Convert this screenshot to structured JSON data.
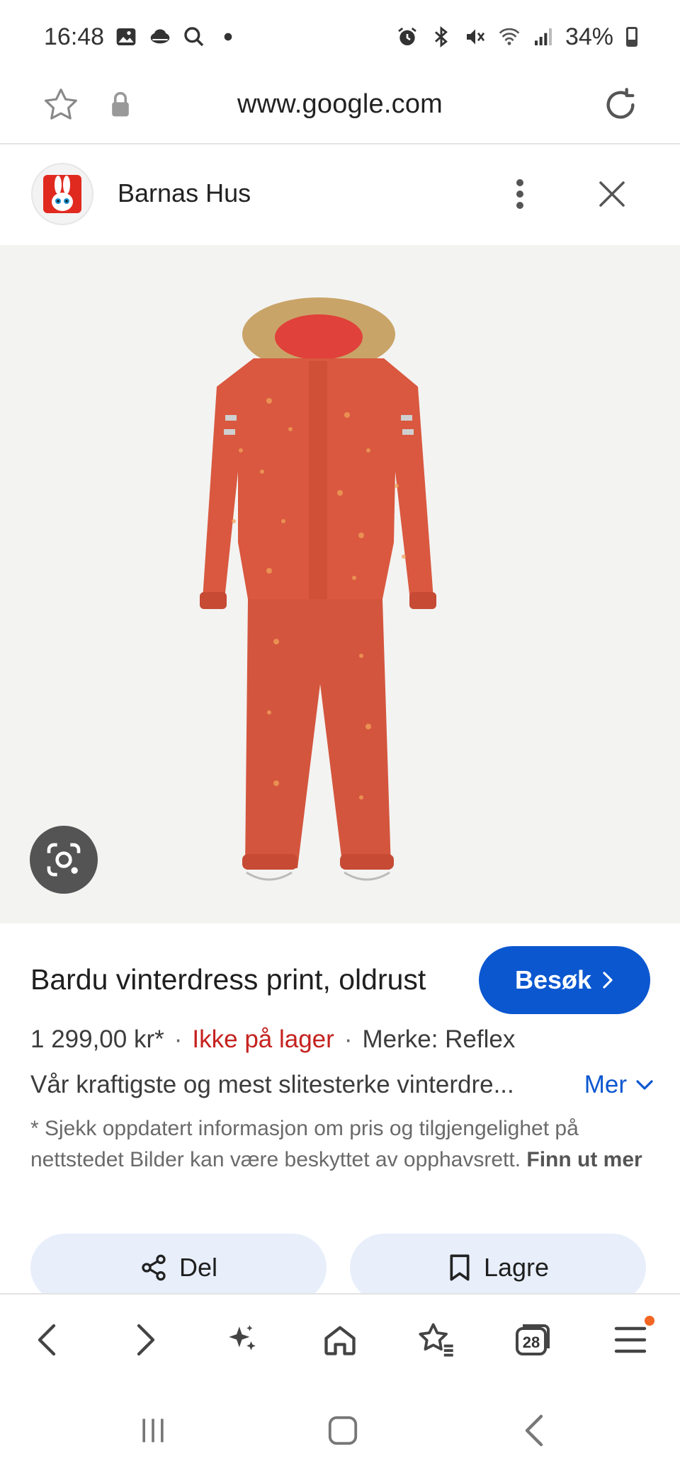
{
  "status_bar": {
    "time": "16:48",
    "battery": "34%"
  },
  "browser": {
    "url": "www.google.com"
  },
  "sheet": {
    "site_name": "Barnas Hus"
  },
  "product": {
    "title": "Bardu vinterdress print, oldrust",
    "visit_label": "Besøk",
    "price": "1 299,00 kr*",
    "stock_status": "Ikke på lager",
    "brand": "Merke: Reflex",
    "description": "Vår kraftigste og mest slitesterke vinterdre...",
    "more_label": "Mer",
    "disclaimer": "* Sjekk oppdatert informasjon om pris og tilgjengelighet på nettstedet Bilder kan være beskyttet av opphavsrett.",
    "disclaimer_link": "Finn ut mer",
    "separator": "·",
    "colors": {
      "accent": "#0b57d0",
      "stock_red": "#c5221f",
      "product_orange": "#d9583f"
    }
  },
  "actions": {
    "share_label": "Del",
    "save_label": "Lagre"
  },
  "toolbar": {
    "tab_count": "28",
    "items": [
      "back-icon",
      "forward-icon",
      "ai-sparkle-icon",
      "home-icon",
      "bookmarks-icon",
      "tabs-icon",
      "menu-icon"
    ]
  }
}
